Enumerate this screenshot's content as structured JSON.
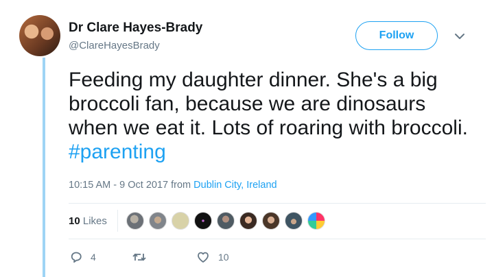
{
  "author": {
    "name": "Dr Clare Hayes-Brady",
    "handle": "@ClareHayesBrady"
  },
  "follow_label": "Follow",
  "tweet": {
    "text": "Feeding my daughter dinner. She's a big broccoli fan, because we are dinosaurs when we eat it. Lots of roaring with broccoli. ",
    "hashtag": "#parenting"
  },
  "meta": {
    "time": "10:15 AM - 9 Oct 2017",
    "from": "from",
    "location": "Dublin City, Ireland"
  },
  "likes": {
    "count": "10",
    "label": "Likes"
  },
  "likers": [
    {
      "icon": "liker-avatar-1",
      "color": "#7a7f86"
    },
    {
      "icon": "liker-avatar-2",
      "color": "#8f949a"
    },
    {
      "icon": "liker-avatar-3",
      "color": "#d8d2a8"
    },
    {
      "icon": "liker-avatar-4",
      "color": "#111111"
    },
    {
      "icon": "liker-avatar-5",
      "color": "#4f5b63"
    },
    {
      "icon": "liker-avatar-6",
      "color": "#6e4a3a"
    },
    {
      "icon": "liker-avatar-7",
      "color": "#5a4838"
    },
    {
      "icon": "liker-avatar-8",
      "color": "#4b5e6a"
    },
    {
      "icon": "liker-avatar-9",
      "color": "#f5f5f5"
    }
  ],
  "actions": {
    "reply_count": "4",
    "retweet_count": "",
    "like_count": "10"
  },
  "colors": {
    "accent": "#1da1f2",
    "muted": "#657786",
    "thread_line": "#9ed4f5"
  }
}
